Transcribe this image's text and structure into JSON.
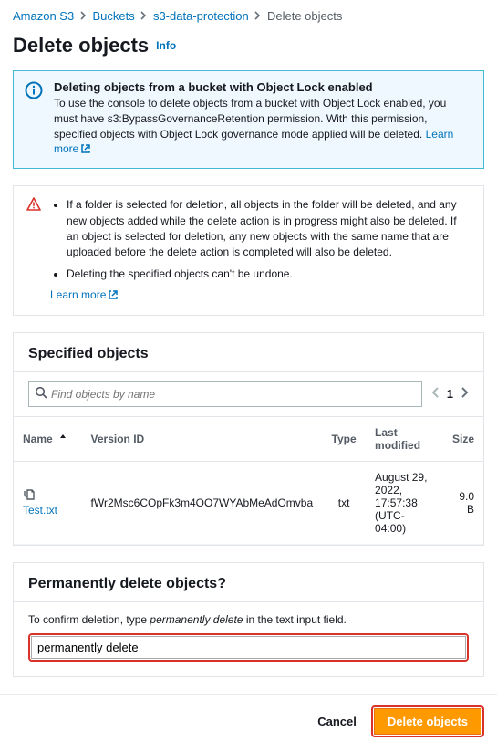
{
  "breadcrumb": {
    "items": [
      "Amazon S3",
      "Buckets",
      "s3-data-protection",
      "Delete objects"
    ],
    "sep": "›"
  },
  "page": {
    "title": "Delete objects",
    "info": "Info"
  },
  "banner": {
    "title": "Deleting objects from a bucket with Object Lock enabled",
    "body": "To use the console to delete objects from a bucket with Object Lock enabled, you must have s3:BypassGovernanceRetention permission. With this permission, specified objects with Object Lock governance mode applied will be deleted.",
    "learn_more": "Learn more"
  },
  "warning": {
    "bullet1": "If a folder is selected for deletion, all objects in the folder will be deleted, and any new objects added while the delete action is in progress might also be deleted. If an object is selected for deletion, any new objects with the same name that are uploaded before the delete action is completed will also be deleted.",
    "bullet2": "Deleting the specified objects can't be undone.",
    "learn_more": "Learn more"
  },
  "specified": {
    "title": "Specified objects",
    "search_placeholder": "Find objects by name",
    "pager": {
      "page": "1"
    },
    "headers": {
      "name": "Name",
      "version": "Version ID",
      "type": "Type",
      "modified": "Last modified",
      "size": "Size"
    },
    "rows": [
      {
        "name": "Test.txt",
        "version": "fWr2Msc6COpFk3m4OO7WYAbMeAdOmvba",
        "type": "txt",
        "modified": "August 29, 2022, 17:57:38 (UTC-04:00)",
        "size": "9.0 B"
      }
    ]
  },
  "confirm": {
    "title": "Permanently delete objects?",
    "label_pre": "To confirm deletion, type ",
    "label_em": "permanently delete",
    "label_post": " in the text input field.",
    "value": "permanently delete"
  },
  "footer": {
    "cancel": "Cancel",
    "delete": "Delete objects"
  }
}
